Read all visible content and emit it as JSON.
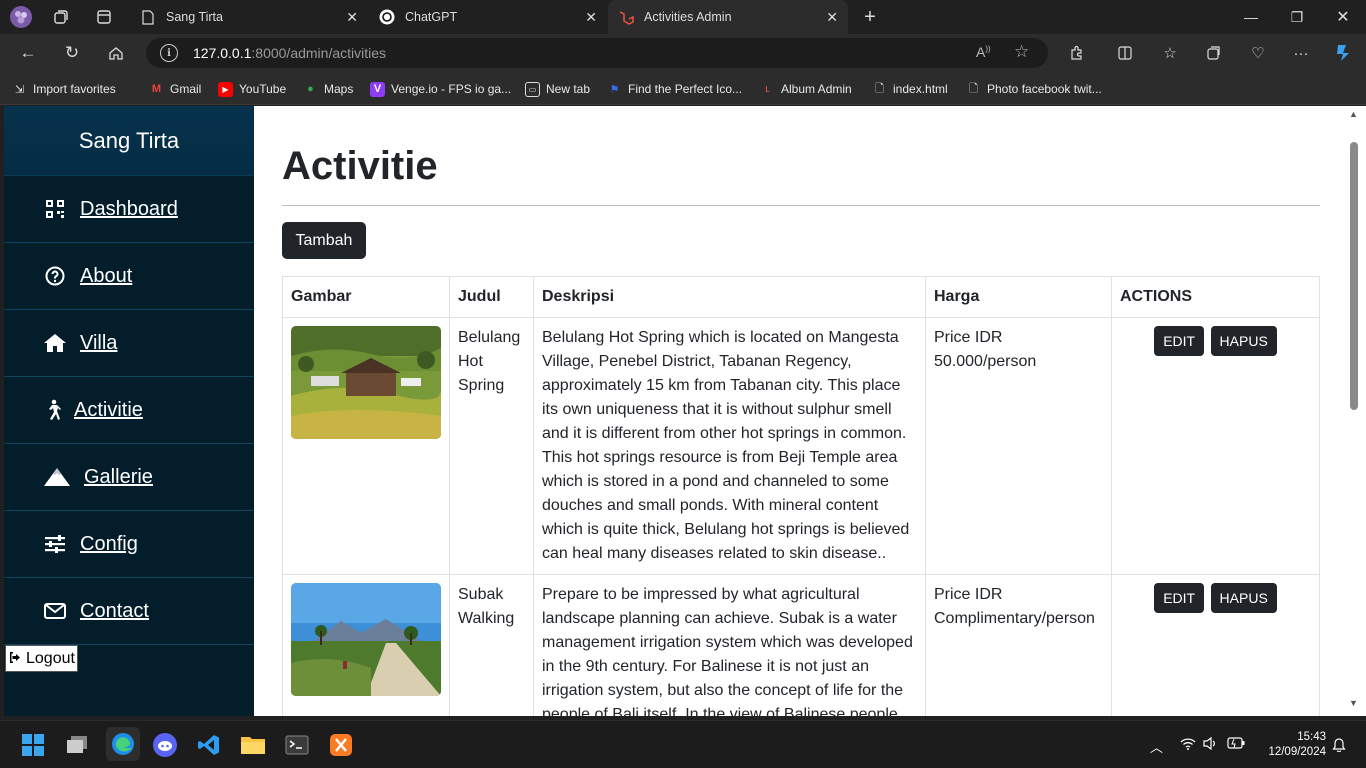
{
  "browser": {
    "tabs": [
      {
        "title": "Sang Tirta"
      },
      {
        "title": "ChatGPT"
      },
      {
        "title": "Activities Admin"
      }
    ],
    "url_host": "127.0.0.1",
    "url_rest": ":8000/admin/activities",
    "favorites": [
      {
        "label": "Import favorites"
      },
      {
        "label": "Gmail"
      },
      {
        "label": "YouTube"
      },
      {
        "label": "Maps"
      },
      {
        "label": "Venge.io - FPS io ga..."
      },
      {
        "label": "New tab"
      },
      {
        "label": "Find the Perfect Ico..."
      },
      {
        "label": "Album Admin"
      },
      {
        "label": "index.html"
      },
      {
        "label": "Photo facebook twit..."
      }
    ]
  },
  "sidebar": {
    "brand": "Sang Tirta",
    "items": [
      {
        "label": "Dashboard",
        "icon": "qr-grid-icon"
      },
      {
        "label": "About",
        "icon": "question-circle-icon"
      },
      {
        "label": "Villa",
        "icon": "home-icon"
      },
      {
        "label": "Activitie",
        "icon": "walking-person-icon"
      },
      {
        "label": "Gallerie",
        "icon": "mountain-icon"
      },
      {
        "label": "Config",
        "icon": "sliders-icon"
      },
      {
        "label": "Contact",
        "icon": "envelope-icon"
      }
    ],
    "logout": "Logout"
  },
  "main": {
    "title": "Activitie",
    "add_button": "Tambah",
    "table": {
      "headers": [
        "Gambar",
        "Judul",
        "Deskripsi",
        "Harga",
        "ACTIONS"
      ],
      "rows": [
        {
          "judul": "Belulang Hot Spring",
          "deskripsi": "Belulang Hot Spring which is located on Mangesta Village, Penebel District, Tabanan Regency, approximately 15 km from Tabanan city. This place its own uniqueness that it is without sulphur smell and it is different from other hot springs in common. This hot springs resource is from Beji Temple area which is stored in a pond and channeled to some douches and small ponds. With mineral content which is quite thick, Belulang hot springs is believed can heal many diseases related to skin disease..",
          "harga": "Price IDR 50.000/person",
          "edit": "EDIT",
          "hapus": "HAPUS"
        },
        {
          "judul": "Subak Walking",
          "deskripsi": "Prepare to be impressed by what agricultural landscape planning can achieve. Subak is a water management irrigation system which was developed in the 9th century. For Balinese it is not just an irrigation system, but also the concept of life for the people of Bali itself. In the view of Balinese people,",
          "harga": "Price IDR Complimentary/person",
          "edit": "EDIT",
          "hapus": "HAPUS"
        }
      ]
    }
  },
  "taskbar": {
    "time": "15:43",
    "date": "12/09/2024"
  }
}
